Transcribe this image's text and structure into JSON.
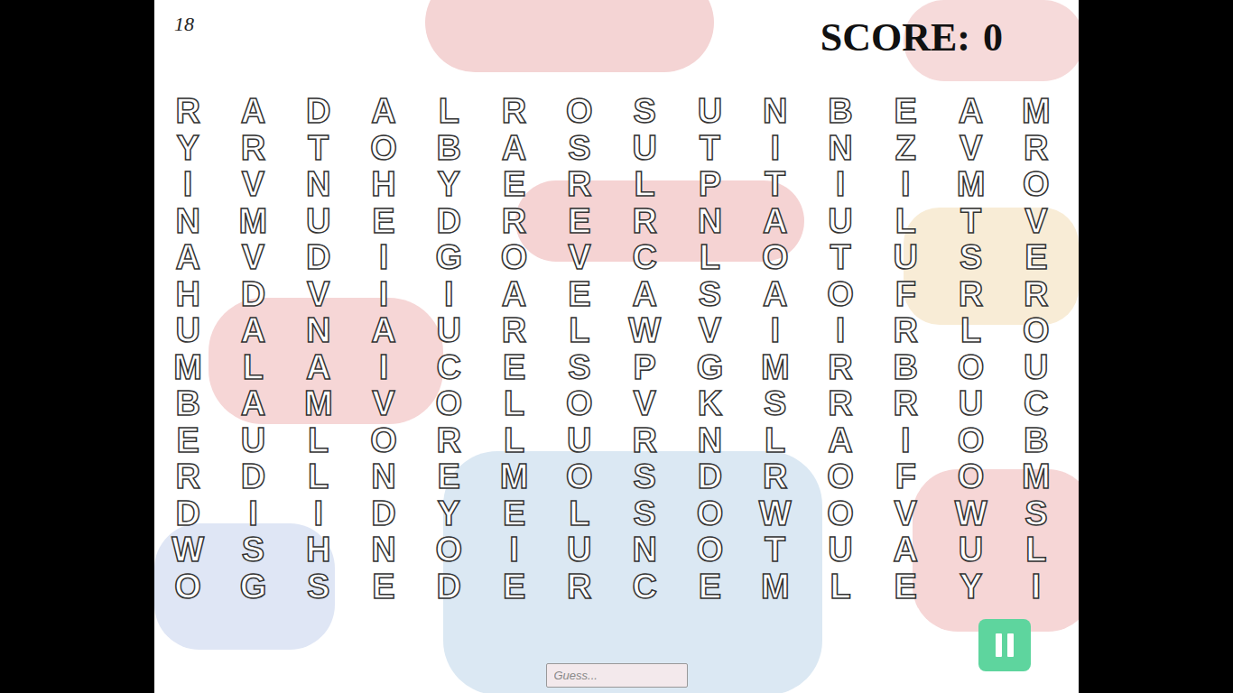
{
  "timer": "18",
  "score": {
    "label": "SCORE:",
    "value": "0"
  },
  "grid": [
    [
      "R",
      "A",
      "D",
      "A",
      "L",
      "R",
      "O",
      "S",
      "U",
      "N",
      "B",
      "E",
      "A",
      "M"
    ],
    [
      "Y",
      "R",
      "T",
      "O",
      "B",
      "A",
      "S",
      "U",
      "T",
      "I",
      "N",
      "Z",
      "V",
      "R"
    ],
    [
      "I",
      "V",
      "N",
      "H",
      "Y",
      "E",
      "R",
      "L",
      "P",
      "T",
      "I",
      "I",
      "M",
      "O"
    ],
    [
      "N",
      "M",
      "U",
      "E",
      "D",
      "R",
      "E",
      "R",
      "N",
      "A",
      "U",
      "L",
      "T",
      "V"
    ],
    [
      "A",
      "V",
      "D",
      "I",
      "G",
      "O",
      "V",
      "C",
      "L",
      "O",
      "T",
      "U",
      "S",
      "E"
    ],
    [
      "H",
      "D",
      "V",
      "I",
      "I",
      "A",
      "E",
      "A",
      "S",
      "A",
      "O",
      "F",
      "R",
      "R"
    ],
    [
      "U",
      "A",
      "N",
      "A",
      "U",
      "R",
      "L",
      "W",
      "V",
      "I",
      "I",
      "R",
      "L",
      "O"
    ],
    [
      "M",
      "L",
      "A",
      "I",
      "C",
      "E",
      "S",
      "P",
      "G",
      "M",
      "R",
      "B",
      "O",
      "U"
    ],
    [
      "B",
      "A",
      "M",
      "V",
      "O",
      "L",
      "O",
      "V",
      "K",
      "S",
      "R",
      "R",
      "U",
      "C"
    ],
    [
      "E",
      "U",
      "L",
      "O",
      "R",
      "L",
      "U",
      "R",
      "N",
      "L",
      "A",
      "I",
      "O",
      "B"
    ],
    [
      "R",
      "D",
      "L",
      "N",
      "E",
      "M",
      "O",
      "S",
      "D",
      "R",
      "O",
      "F",
      "O",
      "M"
    ],
    [
      "D",
      "I",
      "I",
      "D",
      "Y",
      "E",
      "L",
      "S",
      "O",
      "W",
      "O",
      "V",
      "W",
      "S"
    ],
    [
      "W",
      "S",
      "H",
      "N",
      "O",
      "I",
      "U",
      "N",
      "O",
      "T",
      "U",
      "A",
      "U",
      "L"
    ],
    [
      "O",
      "G",
      "S",
      "E",
      "D",
      "E",
      "R",
      "C",
      "E",
      "M",
      "L",
      "E",
      "Y",
      "I"
    ]
  ],
  "guess": {
    "placeholder": "Guess...",
    "value": ""
  },
  "pause_button": {
    "paused": false
  }
}
